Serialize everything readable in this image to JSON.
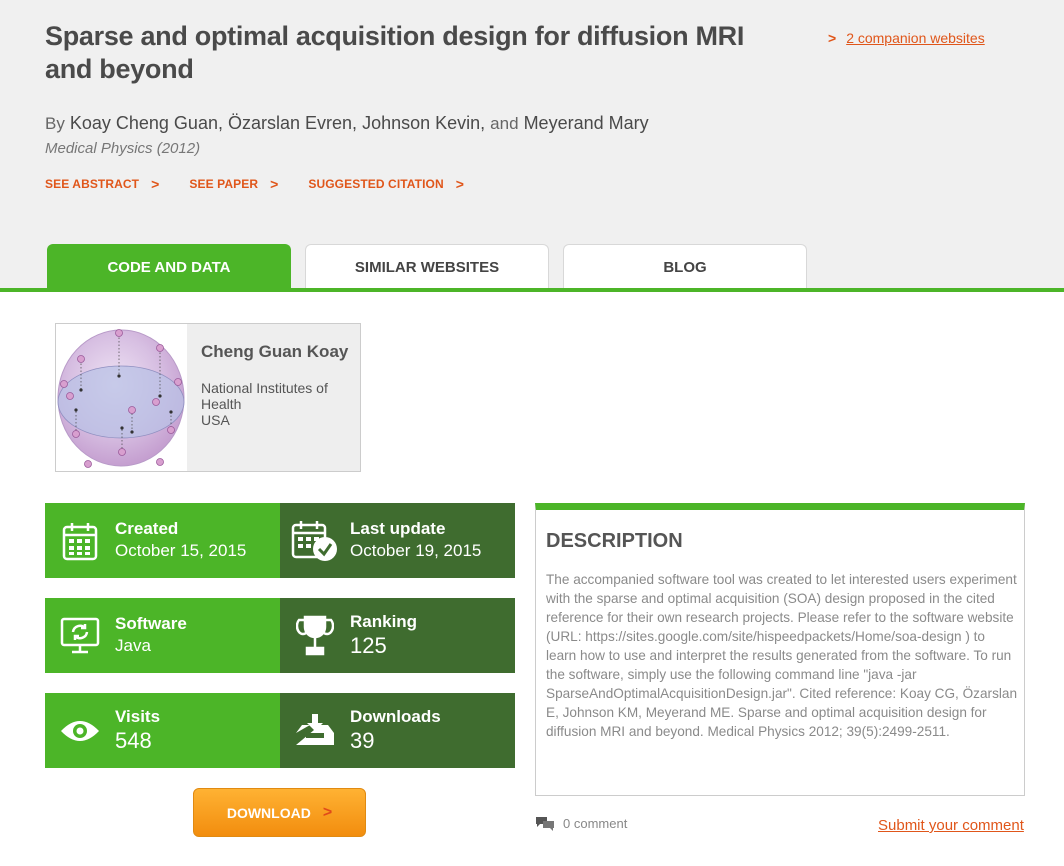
{
  "paper": {
    "title": "Sparse and optimal acquisition design for diffusion MRI and beyond",
    "by": "By",
    "authors": [
      "Koay Cheng Guan,",
      "Özarslan Evren,",
      "Johnson Kevin,",
      "Meyerand Mary"
    ],
    "and": "and",
    "journal": "Medical Physics (2012)"
  },
  "companion": {
    "label": "2 companion websites"
  },
  "actions": [
    "SEE ABSTRACT",
    "SEE PAPER",
    "SUGGESTED CITATION"
  ],
  "tabs": [
    "CODE AND DATA",
    "SIMILAR WEBSITES",
    "BLOG"
  ],
  "author_card": {
    "name": "Cheng Guan Koay",
    "affiliation_line1": "National Institutes of Health",
    "affiliation_line2": "USA"
  },
  "stats": {
    "created": {
      "label": "Created",
      "value": "October 15, 2015"
    },
    "last_update": {
      "label": "Last update",
      "value": "October 19, 2015"
    },
    "software": {
      "label": "Software",
      "value": "Java"
    },
    "ranking": {
      "label": "Ranking",
      "value": "125"
    },
    "visits": {
      "label": "Visits",
      "value": "548"
    },
    "downloads": {
      "label": "Downloads",
      "value": "39"
    }
  },
  "download_button": "DOWNLOAD",
  "description": {
    "heading": "DESCRIPTION",
    "text": "The accompanied software tool was created to let interested users experiment with the sparse and optimal acquisition (SOA) design proposed in the cited reference for their own research projects. Please refer to the software website (URL: https://sites.google.com/site/hispeedpackets/Home/soa-design ) to learn how to use and interpret the results generated from the software. To run the software, simply use the following command line \"java -jar SparseAndOptimalAcquisitionDesign.jar\". Cited reference: Koay CG, Özarslan E, Johnson KM, Meyerand ME. Sparse and optimal acquisition design for diffusion MRI and beyond. Medical Physics 2012; 39(5):2499-2511."
  },
  "comments": {
    "count_label": "0 comment",
    "submit_label": "Submit your comment"
  },
  "colors": {
    "green": "#4cb528",
    "dark_green": "#3f6c2f",
    "orange": "#e0561a"
  }
}
